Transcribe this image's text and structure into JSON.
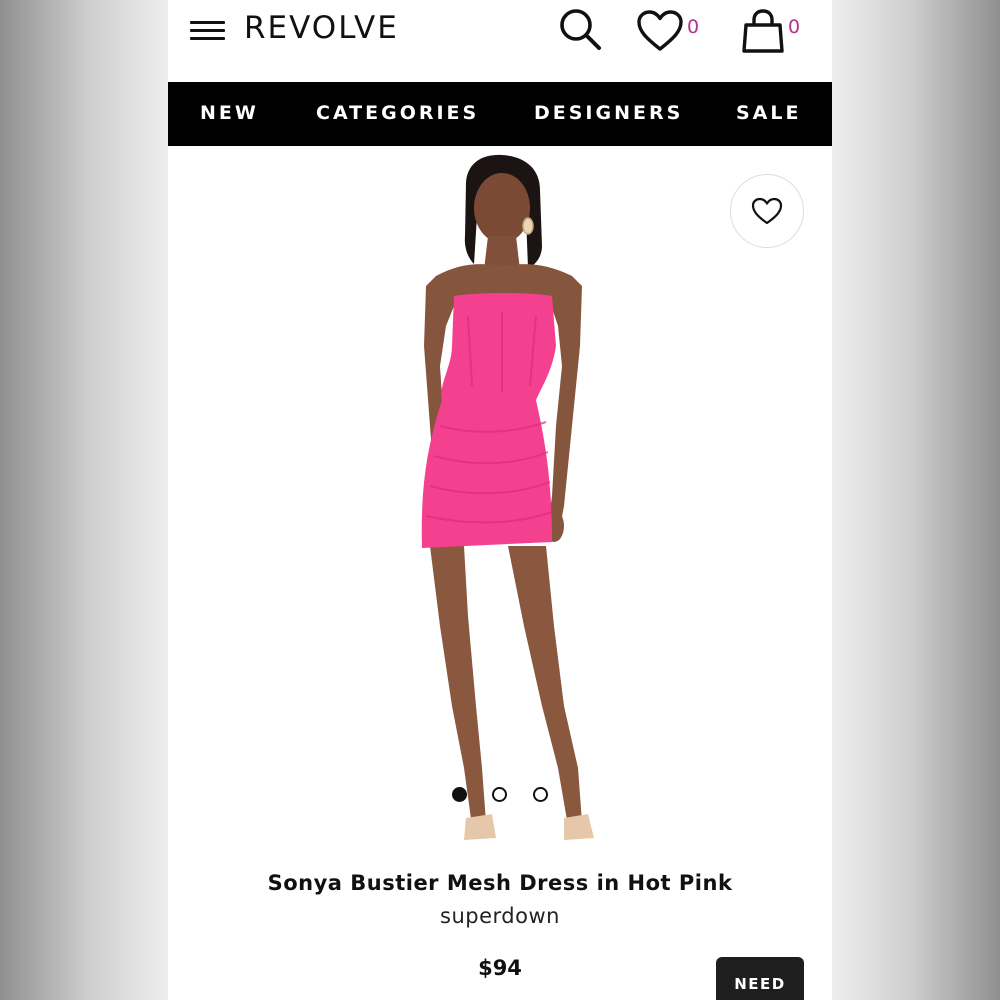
{
  "header": {
    "logo": "REVOLVE",
    "wishlist_count": "0",
    "bag_count": "0",
    "icons": [
      "menu-icon",
      "search-icon",
      "heart-icon",
      "shopping-bag-icon"
    ]
  },
  "nav": {
    "items": [
      "NEW",
      "CATEGORIES",
      "DESIGNERS",
      "SALE"
    ]
  },
  "product": {
    "title": "Sonya Bustier Mesh Dress in Hot Pink",
    "brand": "superdown",
    "price": "$94",
    "image_pages": 3,
    "active_image": 1,
    "dress_color": "#f3418f"
  },
  "buttons": {
    "need_label": "NEED"
  },
  "colors": {
    "nav_bg": "#000000",
    "count_color": "#b0358f",
    "button_bg": "#1e1e1e"
  }
}
